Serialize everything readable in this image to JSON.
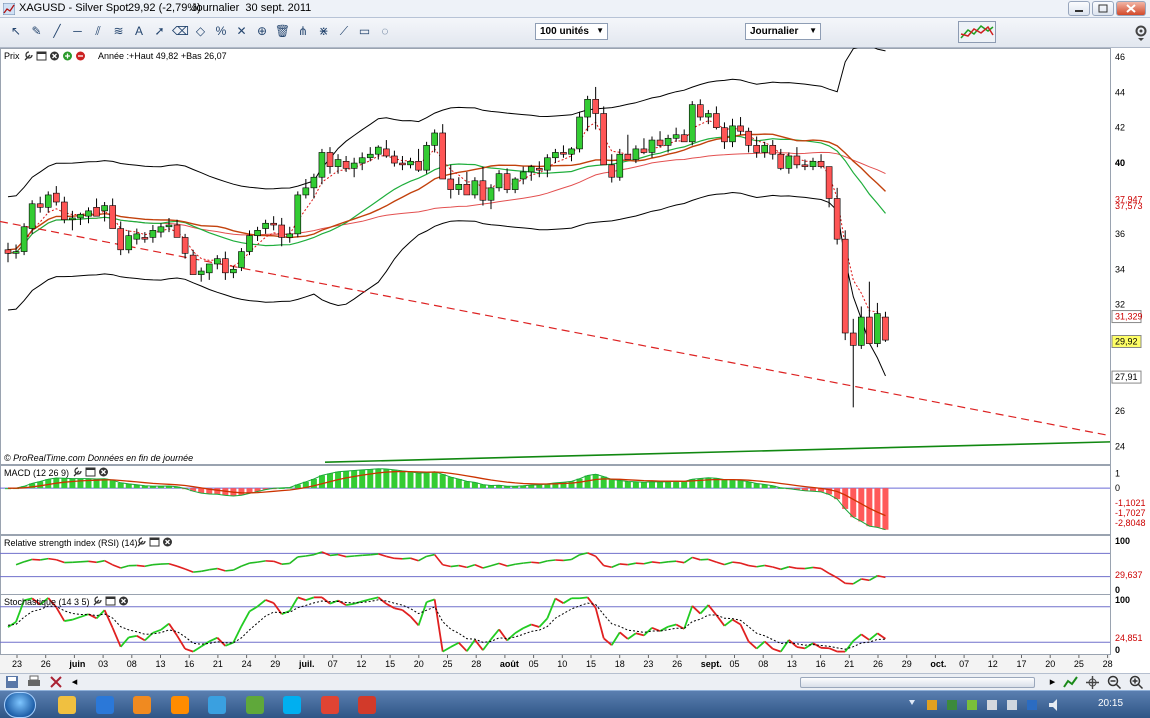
{
  "window": {
    "title_parts": [
      "XAGUSD - Silver Spot",
      "29,92 (-2,79%)",
      "Journalier  30 sept. 2011"
    ],
    "buttons": [
      "minimize",
      "maximize",
      "close"
    ]
  },
  "toolbar": {
    "tool_icons": [
      "pointer-icon",
      "pencil-icon",
      "line-icon",
      "horizontal-line-icon",
      "channel-icon",
      "fibonacci-icon",
      "text-icon",
      "arrow-icon",
      "eraser-icon",
      "shapes-icon",
      "percentage-icon",
      "cross-icon",
      "magnet-icon",
      "trash-icon",
      "fork-icon",
      "gann-icon",
      "speed-icon",
      "rectangle-icon",
      "cycle-icon"
    ],
    "units_select": "100 unités",
    "period_select": "Journalier"
  },
  "panels": {
    "price": {
      "label": "Prix",
      "info": "Année :+Haut 49,82 +Bas 26,07",
      "footer": "© ProRealTime.com  Données en fin de journée"
    },
    "macd": {
      "label": "MACD (12 26 9)"
    },
    "rsi": {
      "label": "Relative strength index (RSI) (14)"
    },
    "stoch": {
      "label": "Stochastique (14 3 5)"
    }
  },
  "chart_data": [
    {
      "type": "candlestick",
      "panel": "price",
      "y_ticks": [
        46,
        44,
        42,
        40,
        36,
        34,
        32,
        26,
        24
      ],
      "ylim": [
        23,
        46.5
      ],
      "x_labels": [
        "23",
        "26",
        "juin",
        "03",
        "08",
        "13",
        "16",
        "21",
        "24",
        "29",
        "juil.",
        "07",
        "12",
        "15",
        "20",
        "25",
        "28",
        "août",
        "05",
        "10",
        "15",
        "18",
        "23",
        "26",
        "sept.",
        "05",
        "08",
        "13",
        "16",
        "21",
        "26",
        "29",
        "oct.",
        "07",
        "12",
        "17",
        "20",
        "25",
        "28"
      ],
      "price_labels": [
        {
          "value": 37.947,
          "text": "37,947",
          "color": "#cc0000",
          "boxed": false
        },
        {
          "value": 37.573,
          "text": "37,573",
          "color": "#cc0000",
          "boxed": false
        },
        {
          "value": 31.329,
          "text": "31,329",
          "color": "#cc0000",
          "boxed": true
        },
        {
          "value": 29.92,
          "text": "29,92",
          "color": "#000000",
          "boxed": true,
          "fill": "#ffff66"
        },
        {
          "value": 27.91,
          "text": "27,91",
          "color": "#000000",
          "boxed": true
        },
        {
          "value": 40,
          "text": "40",
          "color": "#000000",
          "boxed": false,
          "bold": true
        }
      ],
      "candles": [
        [
          35.1,
          35.5,
          34.4,
          34.9
        ],
        [
          34.9,
          35.4,
          34.6,
          35.0
        ],
        [
          35.0,
          36.6,
          34.8,
          36.4
        ],
        [
          36.3,
          37.9,
          36.0,
          37.7
        ],
        [
          37.7,
          38.1,
          37.2,
          37.5
        ],
        [
          37.5,
          38.4,
          37.2,
          38.2
        ],
        [
          38.3,
          38.7,
          37.6,
          37.8
        ],
        [
          37.8,
          38.1,
          36.6,
          36.8
        ],
        [
          36.8,
          37.3,
          36.2,
          36.9
        ],
        [
          36.9,
          37.2,
          36.5,
          37.1
        ],
        [
          37.0,
          37.5,
          36.6,
          37.3
        ],
        [
          37.5,
          38.0,
          37.3,
          37.0
        ],
        [
          37.3,
          37.8,
          36.7,
          37.6
        ],
        [
          37.6,
          38.0,
          37.5,
          36.3
        ],
        [
          36.3,
          36.7,
          34.8,
          35.1
        ],
        [
          35.1,
          36.2,
          34.9,
          35.9
        ],
        [
          35.7,
          36.3,
          35.4,
          36.0
        ],
        [
          35.8,
          36.1,
          35.5,
          35.7
        ],
        [
          35.8,
          36.5,
          35.5,
          36.2
        ],
        [
          36.1,
          36.6,
          35.8,
          36.4
        ],
        [
          36.4,
          36.9,
          36.1,
          36.5
        ],
        [
          36.5,
          36.8,
          36.0,
          35.8
        ],
        [
          35.8,
          36.0,
          34.6,
          34.9
        ],
        [
          34.8,
          35.1,
          34.0,
          33.7
        ],
        [
          33.7,
          34.1,
          33.3,
          33.9
        ],
        [
          33.8,
          34.2,
          33.4,
          34.3
        ],
        [
          34.3,
          34.8,
          34.0,
          34.6
        ],
        [
          34.6,
          35.0,
          33.4,
          33.8
        ],
        [
          33.8,
          34.2,
          33.5,
          34.0
        ],
        [
          34.1,
          35.2,
          33.9,
          35.0
        ],
        [
          35.0,
          36.2,
          34.8,
          35.9
        ],
        [
          35.9,
          36.4,
          35.6,
          36.2
        ],
        [
          36.3,
          36.8,
          36.0,
          36.6
        ],
        [
          36.6,
          37.0,
          36.2,
          36.5
        ],
        [
          36.5,
          36.9,
          35.3,
          35.8
        ],
        [
          35.8,
          36.4,
          35.5,
          36.0
        ],
        [
          36.0,
          38.4,
          35.8,
          38.2
        ],
        [
          38.2,
          39.1,
          38.0,
          38.6
        ],
        [
          38.6,
          39.4,
          38.0,
          39.2
        ],
        [
          39.2,
          40.8,
          38.8,
          40.6
        ],
        [
          40.6,
          40.9,
          39.4,
          39.8
        ],
        [
          39.8,
          40.5,
          39.4,
          40.2
        ],
        [
          40.1,
          40.4,
          39.5,
          39.7
        ],
        [
          39.7,
          40.3,
          39.2,
          40.0
        ],
        [
          40.0,
          40.6,
          39.6,
          40.3
        ],
        [
          40.3,
          40.9,
          40.1,
          40.5
        ],
        [
          40.5,
          41.0,
          40.2,
          40.9
        ],
        [
          40.8,
          41.3,
          40.3,
          40.4
        ],
        [
          40.4,
          40.7,
          39.8,
          40.0
        ],
        [
          40.0,
          40.4,
          39.6,
          39.9
        ],
        [
          39.9,
          40.3,
          39.7,
          40.1
        ],
        [
          40.1,
          40.8,
          39.5,
          39.6
        ],
        [
          39.6,
          41.2,
          39.4,
          41.0
        ],
        [
          41.0,
          41.9,
          40.6,
          41.7
        ],
        [
          41.7,
          42.2,
          39.6,
          39.1
        ],
        [
          39.1,
          39.9,
          38.0,
          38.5
        ],
        [
          38.5,
          39.2,
          38.2,
          38.8
        ],
        [
          38.8,
          39.5,
          38.4,
          38.2
        ],
        [
          38.2,
          39.2,
          38.0,
          39.0
        ],
        [
          39.0,
          39.8,
          37.6,
          37.9
        ],
        [
          37.9,
          38.8,
          37.4,
          38.6
        ],
        [
          38.6,
          39.6,
          38.4,
          39.4
        ],
        [
          39.4,
          39.7,
          38.3,
          38.5
        ],
        [
          38.5,
          39.2,
          38.3,
          39.1
        ],
        [
          39.1,
          39.8,
          38.8,
          39.5
        ],
        [
          39.5,
          39.9,
          39.0,
          39.8
        ],
        [
          39.7,
          40.1,
          39.2,
          39.6
        ],
        [
          39.6,
          40.5,
          39.2,
          40.3
        ],
        [
          40.3,
          40.8,
          40.0,
          40.6
        ],
        [
          40.6,
          41.0,
          40.3,
          40.5
        ],
        [
          40.5,
          40.9,
          40.1,
          40.8
        ],
        [
          40.8,
          42.9,
          40.6,
          42.6
        ],
        [
          42.6,
          43.8,
          41.8,
          43.6
        ],
        [
          43.6,
          44.3,
          41.9,
          42.8
        ],
        [
          42.8,
          43.2,
          41.5,
          39.9
        ],
        [
          39.9,
          40.5,
          38.9,
          39.2
        ],
        [
          39.2,
          40.8,
          39.0,
          40.5
        ],
        [
          40.5,
          41.6,
          40.2,
          40.2
        ],
        [
          40.2,
          41.0,
          40.0,
          40.8
        ],
        [
          40.8,
          41.4,
          40.5,
          40.6
        ],
        [
          40.6,
          41.5,
          40.3,
          41.3
        ],
        [
          41.3,
          41.8,
          40.9,
          41.0
        ],
        [
          41.0,
          41.6,
          40.6,
          41.4
        ],
        [
          41.4,
          42.0,
          41.2,
          41.6
        ],
        [
          41.6,
          41.9,
          41.2,
          41.2
        ],
        [
          41.2,
          43.5,
          41.0,
          43.3
        ],
        [
          43.3,
          43.6,
          42.4,
          42.6
        ],
        [
          42.6,
          43.0,
          42.2,
          42.8
        ],
        [
          42.8,
          43.2,
          41.9,
          42.0
        ],
        [
          42.0,
          42.3,
          40.8,
          41.2
        ],
        [
          41.2,
          42.5,
          40.9,
          42.1
        ],
        [
          42.1,
          42.6,
          41.6,
          41.8
        ],
        [
          41.8,
          42.0,
          40.6,
          41.0
        ],
        [
          41.0,
          41.5,
          40.3,
          40.6
        ],
        [
          40.6,
          41.2,
          40.3,
          41.0
        ],
        [
          41.0,
          41.3,
          40.2,
          40.5
        ],
        [
          40.5,
          40.8,
          39.6,
          39.7
        ],
        [
          39.7,
          40.6,
          39.4,
          40.4
        ],
        [
          40.4,
          40.9,
          39.7,
          39.9
        ],
        [
          39.9,
          40.2,
          39.6,
          39.8
        ],
        [
          39.8,
          40.3,
          39.6,
          40.1
        ],
        [
          40.1,
          40.5,
          39.7,
          39.8
        ],
        [
          39.8,
          39.8,
          37.5,
          38.0
        ],
        [
          38.0,
          38.6,
          35.4,
          35.7
        ],
        [
          35.7,
          36.2,
          30.0,
          30.4
        ],
        [
          30.4,
          31.2,
          26.2,
          29.7
        ],
        [
          29.7,
          31.9,
          29.5,
          31.3
        ],
        [
          31.3,
          33.3,
          29.9,
          29.8
        ],
        [
          29.8,
          32.1,
          29.6,
          31.5
        ],
        [
          31.3,
          31.6,
          29.9,
          30.0
        ]
      ],
      "overlays": [
        {
          "name": "Bollinger upper",
          "color": "#000000",
          "style": "solid"
        },
        {
          "name": "Bollinger lower",
          "color": "#000000",
          "style": "solid"
        },
        {
          "name": "Moyenne 20",
          "color": "#22aa22",
          "style": "solid"
        },
        {
          "name": "Moyenne 50",
          "color": "#e03030",
          "style": "solid"
        },
        {
          "name": "Moyenne 100",
          "color": "#cc3300",
          "style": "solid"
        },
        {
          "name": "Support oblique",
          "color": "#dd2222",
          "style": "dashed"
        },
        {
          "name": "Support long terme",
          "color": "#118811",
          "style": "solid"
        }
      ]
    },
    {
      "type": "histogram-line",
      "panel": "macd",
      "y_ticks": [
        1,
        0
      ],
      "ylim": [
        -3.1,
        1.5
      ],
      "value_labels": [
        {
          "value": -1.1021,
          "text": "-1,1021",
          "color": "#cc0000"
        },
        {
          "value": -1.7027,
          "text": "-1,7027",
          "color": "#cc0000"
        },
        {
          "value": -2.8048,
          "text": "-2,8048",
          "color": "#cc0000"
        }
      ]
    },
    {
      "type": "line",
      "panel": "rsi",
      "y_ticks": [
        100,
        0
      ],
      "ylim": [
        0,
        100
      ],
      "bands": [
        70,
        30
      ],
      "value_labels": [
        {
          "value": 29.637,
          "text": "29,637",
          "color": "#cc0000"
        }
      ]
    },
    {
      "type": "line",
      "panel": "stoch",
      "y_ticks": [
        100,
        0
      ],
      "ylim": [
        0,
        100
      ],
      "bands": [
        80,
        20
      ],
      "value_labels": [
        {
          "value": 24.851,
          "text": "24,851",
          "color": "#cc0000"
        }
      ]
    }
  ],
  "scrollbar": {},
  "taskbar": {
    "icons": [
      "explorer-icon",
      "ie-icon",
      "media-icon",
      "vlc-icon",
      "network-icon",
      "app-icon",
      "skype-icon",
      "chrome-icon",
      "prorealtime-icon"
    ],
    "clock": "20:15"
  }
}
